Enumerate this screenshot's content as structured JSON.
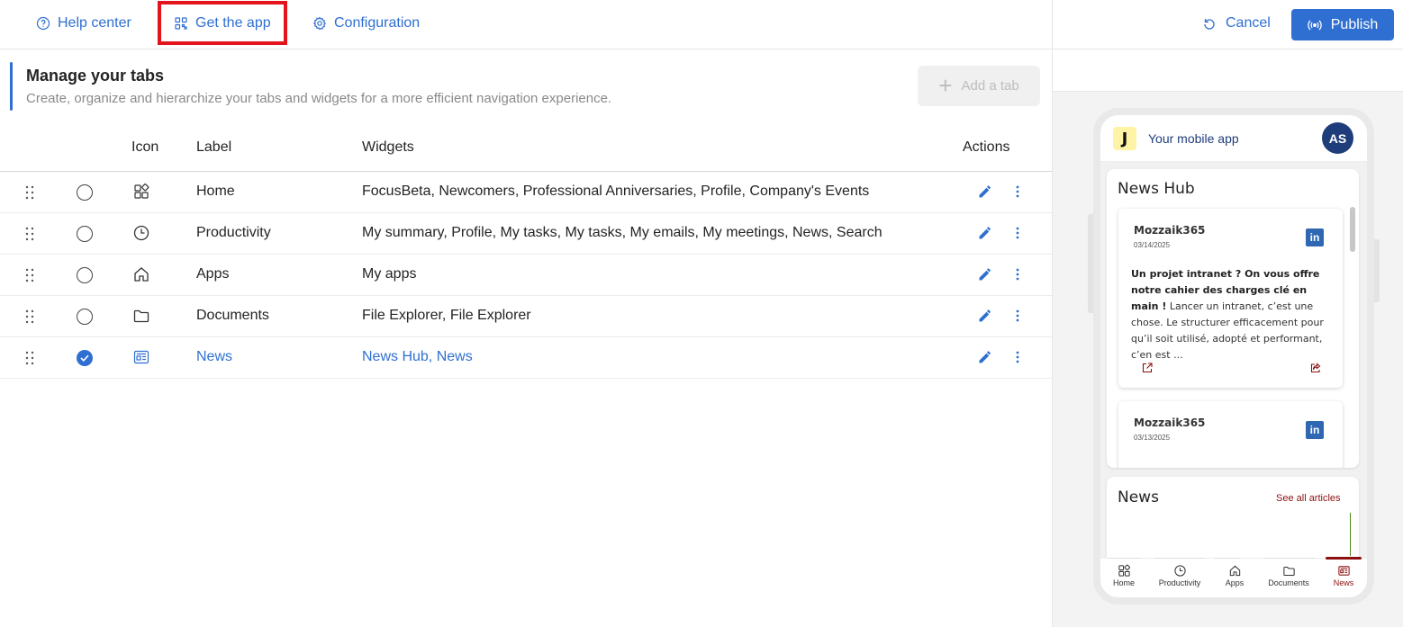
{
  "topbar": {
    "help_label": "Help center",
    "getapp_label": "Get the app",
    "config_label": "Configuration",
    "cancel_label": "Cancel",
    "publish_label": "Publish"
  },
  "section": {
    "title": "Manage your tabs",
    "subtitle": "Create, organize and hierarchize your tabs and widgets for a more efficient navigation experience.",
    "add_tab_label": "Add a tab"
  },
  "table": {
    "headers": {
      "icon": "Icon",
      "label": "Label",
      "widgets": "Widgets",
      "actions": "Actions"
    },
    "rows": [
      {
        "icon": "apps-grid-icon",
        "label": "Home",
        "widgets": "FocusBeta, Newcomers, Professional Anniversaries, Profile, Company's Events",
        "selected": false
      },
      {
        "icon": "clock-icon",
        "label": "Productivity",
        "widgets": "My summary, Profile, My tasks, My tasks, My emails, My meetings, News, Search",
        "selected": false
      },
      {
        "icon": "home-icon",
        "label": "Apps",
        "widgets": "My apps",
        "selected": false
      },
      {
        "icon": "folder-icon",
        "label": "Documents",
        "widgets": "File Explorer, File Explorer",
        "selected": false
      },
      {
        "icon": "news-icon",
        "label": "News",
        "widgets": "News Hub, News",
        "selected": true
      }
    ]
  },
  "preview": {
    "logo_letter": "J",
    "app_title": "Your mobile app",
    "avatar_initials": "AS",
    "news_hub": {
      "title": "News Hub",
      "posts": [
        {
          "author": "Mozzaik365",
          "date": "03/14/2025",
          "bold_text": "Un projet intranet ? On vous offre notre cahier des charges clé en main !",
          "text": "Lancer un intranet, c’est une chose. Le structurer efficacement pour qu’il soit utilisé, adopté et performant, c’en est ..."
        },
        {
          "author": "Mozzaik365",
          "date": "03/13/2025"
        }
      ]
    },
    "news": {
      "title": "News",
      "see_all": "See all articles"
    },
    "bottom_nav": [
      "Home",
      "Productivity",
      "Apps",
      "Documents",
      "News"
    ]
  },
  "colors": {
    "accent": "#2f6fd1",
    "highlight": "#e3141b",
    "preview_accent": "#8b1010",
    "avatar": "#1f3d7a"
  }
}
